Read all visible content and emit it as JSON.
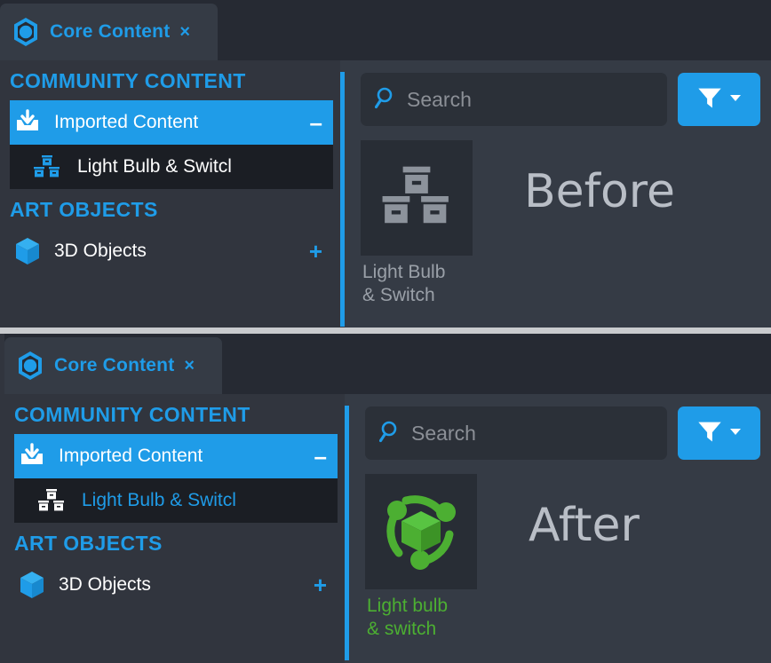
{
  "colors": {
    "accent_blue": "#1f9ce8",
    "green": "#4caf32",
    "panel_bg": "#353b45",
    "sidebar_bg": "#31353e",
    "tabbar_bg": "#262a33",
    "thumb_bg": "#282d35",
    "divider_gray": "#c9cbce"
  },
  "before": {
    "label": "Before",
    "tab": {
      "title": "Core Content",
      "close": "×",
      "icon": "core-content-hex-icon"
    },
    "search": {
      "placeholder": "Search",
      "value": "",
      "icon": "search-icon"
    },
    "filter": {
      "icon": "filter-icon",
      "caret": "chevron-down-icon"
    },
    "sections": [
      {
        "title": "COMMUNITY CONTENT",
        "items": [
          {
            "label": "Imported Content",
            "icon": "import-tray-icon",
            "affix": "–",
            "affix_kind": "minus",
            "state": "selected"
          },
          {
            "label": "Light Bulb & Switcl",
            "icon": "boxes-icon",
            "affix": "",
            "affix_kind": "none",
            "state": "child"
          }
        ]
      },
      {
        "title": "ART OBJECTS",
        "items": [
          {
            "label": "3D Objects",
            "icon": "cube-icon",
            "affix": "+",
            "affix_kind": "plus",
            "state": "normal"
          }
        ]
      }
    ],
    "asset": {
      "caption_line1": "Light Bulb",
      "caption_line2": "& Switch",
      "thumb_icon": "boxes-thumbnail-icon",
      "thumb_color": "#8d939c"
    }
  },
  "after": {
    "label": "After",
    "tab": {
      "title": "Core Content",
      "close": "×",
      "icon": "core-content-hex-icon"
    },
    "search": {
      "placeholder": "Search",
      "value": "",
      "icon": "search-icon"
    },
    "filter": {
      "icon": "filter-icon",
      "caret": "chevron-down-icon"
    },
    "sections": [
      {
        "title": "COMMUNITY CONTENT",
        "items": [
          {
            "label": "Imported Content",
            "icon": "import-tray-icon",
            "affix": "–",
            "affix_kind": "minus",
            "state": "selected"
          },
          {
            "label": "Light Bulb & Switcl",
            "icon": "boxes-icon",
            "affix": "",
            "affix_kind": "none",
            "state": "child"
          }
        ]
      },
      {
        "title": "ART OBJECTS",
        "items": [
          {
            "label": "3D Objects",
            "icon": "cube-icon",
            "affix": "+",
            "affix_kind": "plus",
            "state": "normal"
          }
        ]
      }
    ],
    "asset": {
      "caption_line1": "Light bulb",
      "caption_line2": "& switch",
      "thumb_icon": "orbital-cube-icon",
      "thumb_color": "#4caf32"
    }
  }
}
